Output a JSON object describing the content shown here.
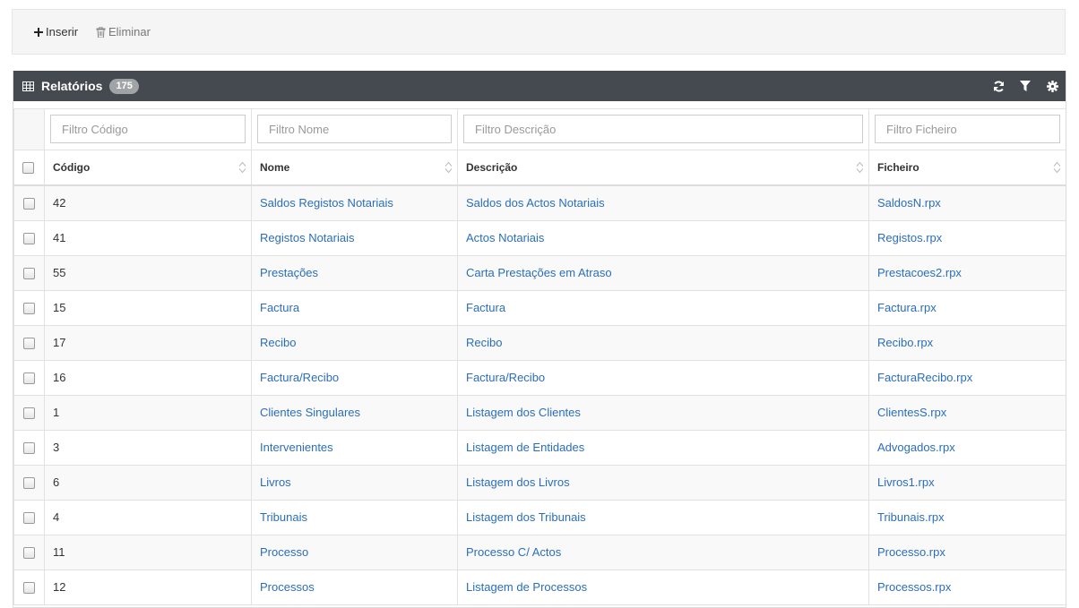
{
  "toolbar": {
    "insert_label": "Inserir",
    "delete_label": "Eliminar"
  },
  "panel": {
    "title": "Relatórios",
    "count": "175",
    "tools": [
      "refresh-icon",
      "filter-icon",
      "gear-icon"
    ]
  },
  "filters": {
    "codigo_placeholder": "Filtro Código",
    "nome_placeholder": "Filtro Nome",
    "descricao_placeholder": "Filtro Descrição",
    "ficheiro_placeholder": "Filtro Ficheiro"
  },
  "columns": {
    "codigo": "Código",
    "nome": "Nome",
    "descricao": "Descrição",
    "ficheiro": "Ficheiro"
  },
  "rows": [
    {
      "codigo": "42",
      "nome": "Saldos Registos Notariais",
      "descricao": "Saldos dos Actos Notariais",
      "ficheiro": "SaldosN.rpx"
    },
    {
      "codigo": "41",
      "nome": "Registos Notariais",
      "descricao": "Actos Notariais",
      "ficheiro": "Registos.rpx"
    },
    {
      "codigo": "55",
      "nome": "Prestações",
      "descricao": "Carta Prestações em Atraso",
      "ficheiro": "Prestacoes2.rpx"
    },
    {
      "codigo": "15",
      "nome": "Factura",
      "descricao": "Factura",
      "ficheiro": "Factura.rpx"
    },
    {
      "codigo": "17",
      "nome": "Recibo",
      "descricao": "Recibo",
      "ficheiro": "Recibo.rpx"
    },
    {
      "codigo": "16",
      "nome": "Factura/Recibo",
      "descricao": "Factura/Recibo",
      "ficheiro": "FacturaRecibo.rpx"
    },
    {
      "codigo": "1",
      "nome": "Clientes Singulares",
      "descricao": "Listagem dos Clientes",
      "ficheiro": "ClientesS.rpx"
    },
    {
      "codigo": "3",
      "nome": "Intervenientes",
      "descricao": "Listagem de Entidades",
      "ficheiro": "Advogados.rpx"
    },
    {
      "codigo": "6",
      "nome": "Livros",
      "descricao": "Listagem dos Livros",
      "ficheiro": "Livros1.rpx"
    },
    {
      "codigo": "4",
      "nome": "Tribunais",
      "descricao": "Listagem dos Tribunais",
      "ficheiro": "Tribunais.rpx"
    },
    {
      "codigo": "11",
      "nome": "Processo",
      "descricao": "Processo C/ Actos",
      "ficheiro": "Processo.rpx"
    },
    {
      "codigo": "12",
      "nome": "Processos",
      "descricao": "Listagem de Processos",
      "ficheiro": "Processos.rpx"
    }
  ]
}
